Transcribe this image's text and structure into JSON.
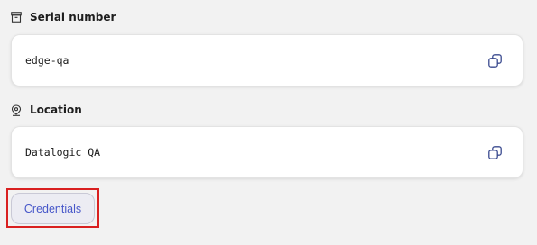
{
  "fields": [
    {
      "label": "Serial number",
      "icon": "archive-box-icon",
      "value": "edge-qa",
      "action_icon": "copy-icon"
    },
    {
      "label": "Location",
      "icon": "location-pin-icon",
      "value": "Datalogic QA",
      "action_icon": "copy-icon"
    }
  ],
  "credentials_button": {
    "label": "Credentials",
    "highlighted": true
  },
  "colors": {
    "background": "#f2f2f2",
    "card": "#ffffff",
    "accent": "#4757c9",
    "highlight": "#d92020"
  }
}
